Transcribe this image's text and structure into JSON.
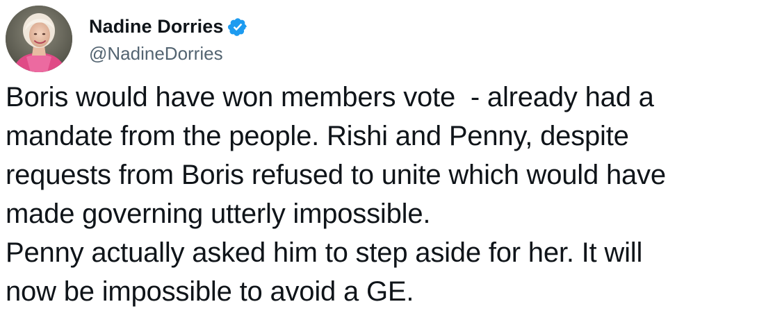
{
  "author": {
    "display_name": "Nadine Dorries",
    "handle": "@NadineDorries",
    "verified": true,
    "verified_icon": "verified-badge-icon",
    "verified_color": "#1d9bf0",
    "avatar_icon": "profile-photo"
  },
  "tweet": {
    "lines": [
      "Boris would have won members vote  - already had a",
      "mandate from the people. Rishi and Penny, despite",
      "requests from Boris refused to unite which would have",
      "made governing utterly impossible.",
      "Penny actually asked him to step aside for her. It will",
      "now be impossible to avoid a GE."
    ]
  },
  "colors": {
    "text": "#0f1419",
    "secondary_text": "#536471",
    "background": "#ffffff"
  }
}
